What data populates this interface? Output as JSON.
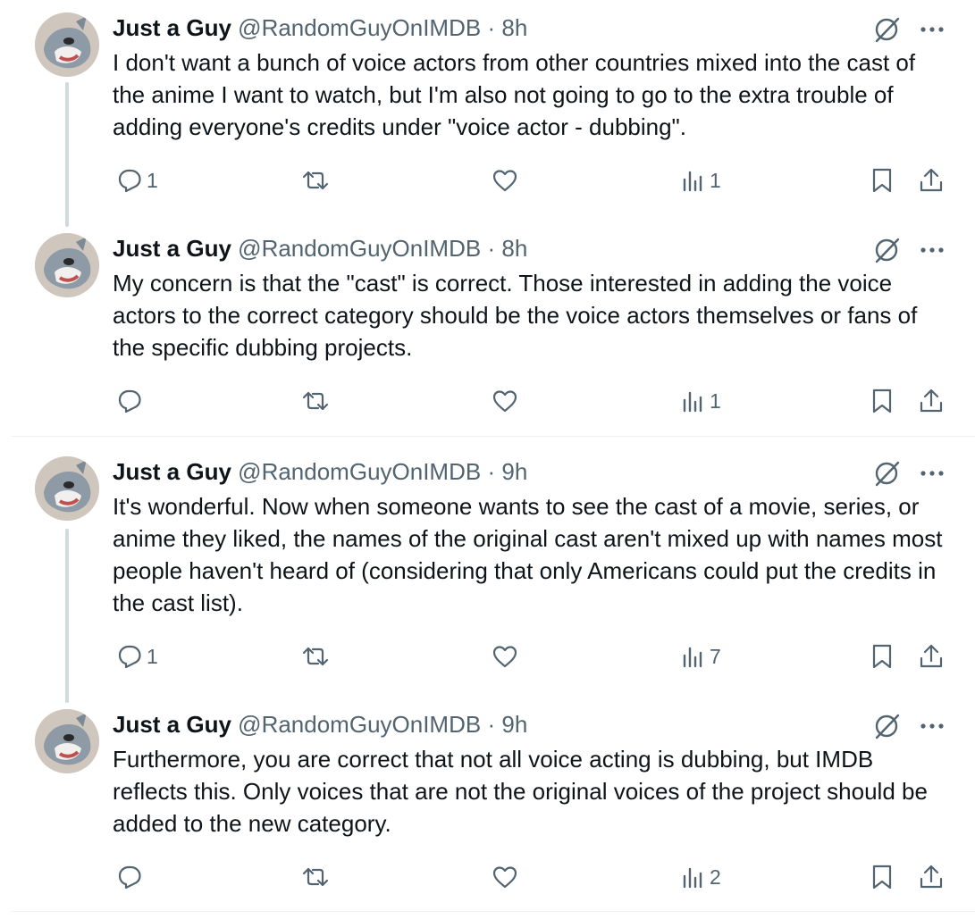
{
  "tweets": [
    {
      "name": "Just a Guy",
      "handle": "@RandomGuyOnIMDB",
      "dot": "·",
      "time": "8h",
      "text": "I don't want a bunch of voice actors from other countries mixed into the cast of the anime I want to watch, but I'm also not going to go to the extra trouble of adding everyone's credits under \"voice actor - dubbing\".",
      "replies": "1",
      "retweets": "",
      "likes": "",
      "views": "1"
    },
    {
      "name": "Just a Guy",
      "handle": "@RandomGuyOnIMDB",
      "dot": "·",
      "time": "8h",
      "text": "My concern is that the \"cast\" is correct. Those interested in adding the voice actors to the correct category should be the voice actors themselves or fans of the specific dubbing projects.",
      "replies": "",
      "retweets": "",
      "likes": "",
      "views": "1"
    },
    {
      "name": "Just a Guy",
      "handle": "@RandomGuyOnIMDB",
      "dot": "·",
      "time": "9h",
      "text": "It's wonderful. Now when someone wants to see the cast of a movie, series, or anime they liked, the names of the original cast aren't mixed up with names most people haven't heard of (considering that only Americans could put the credits in the cast list).",
      "replies": "1",
      "retweets": "",
      "likes": "",
      "views": "7"
    },
    {
      "name": "Just a Guy",
      "handle": "@RandomGuyOnIMDB",
      "dot": "·",
      "time": "9h",
      "text": "Furthermore, you are correct that not all voice acting is dubbing, but IMDB reflects this. Only voices that are not the original voices of the project should be added to the new category.",
      "replies": "",
      "retweets": "",
      "likes": "",
      "views": "2"
    }
  ],
  "icons": {
    "reply": "reply-icon",
    "retweet": "retweet-icon",
    "like": "heart-icon",
    "views": "views-icon",
    "bookmark": "bookmark-icon",
    "share": "share-icon",
    "grok": "grok-icon",
    "more": "more-icon"
  },
  "colors": {
    "text": "#0f1419",
    "secondary": "#536471",
    "thread_line": "#cfd9de",
    "separator": "#eff3f4"
  }
}
